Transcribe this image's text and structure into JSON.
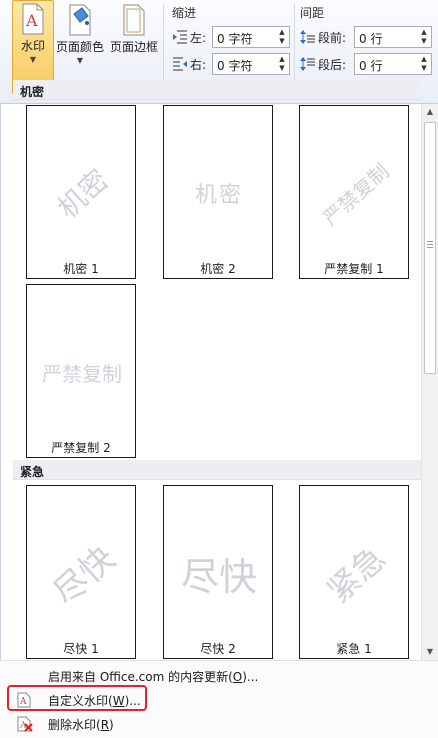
{
  "ribbon": {
    "watermark_label": "水印",
    "page_color_label": "页面颜色",
    "page_border_label": "页面边框",
    "indent": {
      "title": "缩进",
      "left_label": "左:",
      "left_value": "0 字符",
      "right_label": "右:",
      "right_value": "0 字符"
    },
    "spacing": {
      "title": "间距",
      "before_label": "段前:",
      "before_value": "0 行",
      "after_label": "段后:",
      "after_value": "0 行"
    }
  },
  "gallery": {
    "sections": [
      {
        "header": "机密",
        "items": [
          {
            "caption": "机密 1",
            "watermark": "机密",
            "style": "diagonal"
          },
          {
            "caption": "机密 2",
            "watermark": "机密",
            "style": "horizontal"
          },
          {
            "caption": "严禁复制 1",
            "watermark": "严禁复制",
            "style": "diagonal"
          },
          {
            "caption": "严禁复制 2",
            "watermark": "严禁复制",
            "style": "horizontal"
          }
        ]
      },
      {
        "header": "紧急",
        "items": [
          {
            "caption": "尽快 1",
            "watermark": "尽快",
            "style": "diagonal"
          },
          {
            "caption": "尽快 2",
            "watermark": "尽快",
            "style": "horizontal"
          },
          {
            "caption": "紧急 1",
            "watermark": "紧急",
            "style": "diagonal"
          }
        ]
      }
    ]
  },
  "menu": {
    "office_update": {
      "text": "启用来自 Office.com 的内容更新(",
      "key": "O",
      "suffix": ")..."
    },
    "custom_watermark": {
      "text": "自定义水印(",
      "key": "W",
      "suffix": ")..."
    },
    "remove_watermark": {
      "text": "删除水印(",
      "key": "R",
      "suffix": ")"
    }
  },
  "colors": {
    "watermark_button_bg": "#f8c95c",
    "highlight_border": "#e3232b",
    "watermark_text": "#cfd3d8"
  }
}
